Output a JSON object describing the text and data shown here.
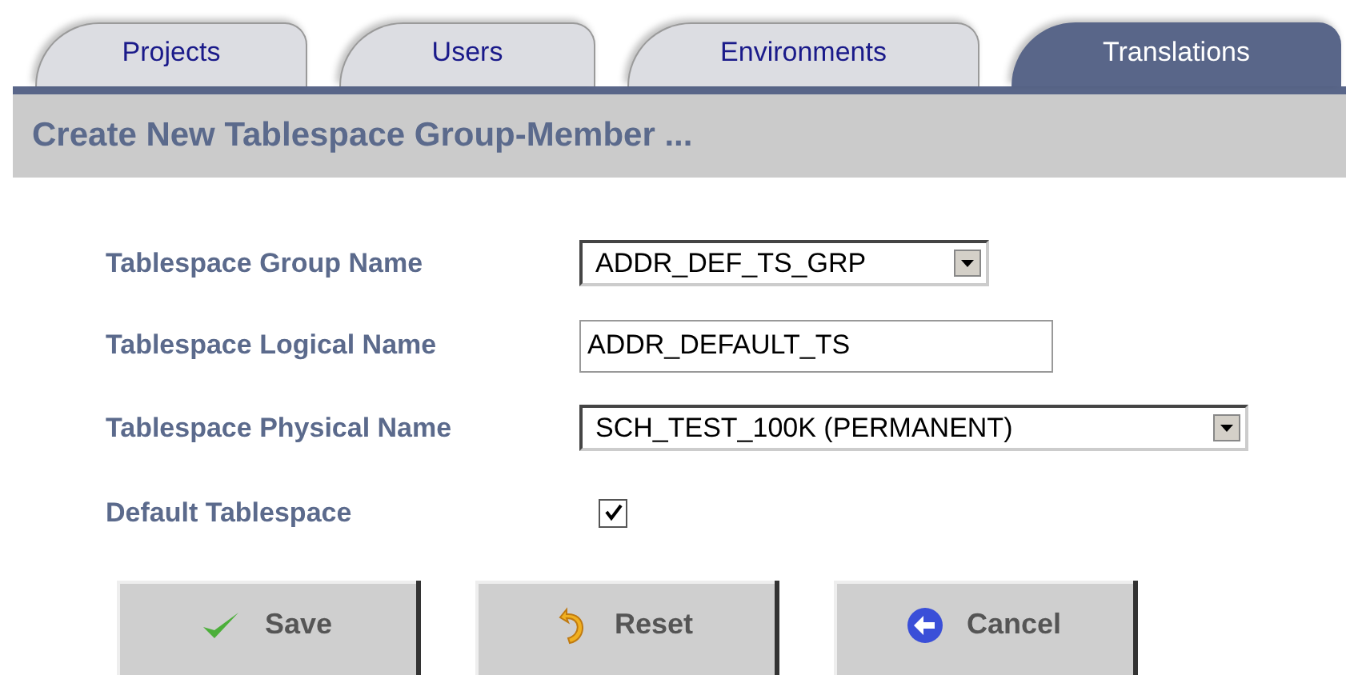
{
  "tabs": [
    {
      "label": "Projects",
      "selected": false
    },
    {
      "label": "Users",
      "selected": false
    },
    {
      "label": "Environments",
      "selected": false
    },
    {
      "label": "Translations",
      "selected": true
    }
  ],
  "header": {
    "title": "Create New Tablespace Group-Member ..."
  },
  "fields": [
    {
      "kind": "select",
      "label": "Tablespace Group Name",
      "value": "ADDR_DEF_TS_GRP",
      "wide": false
    },
    {
      "kind": "text",
      "label": "Tablespace Logical Name",
      "value": "ADDR_DEFAULT_TS"
    },
    {
      "kind": "select",
      "label": "Tablespace Physical Name",
      "value": "SCH_TEST_100K (PERMANENT)",
      "wide": true
    },
    {
      "kind": "checkbox",
      "label": "Default Tablespace",
      "checked": true
    }
  ],
  "buttons": [
    {
      "kind": "save",
      "label": "Save"
    },
    {
      "kind": "reset",
      "label": "Reset"
    },
    {
      "kind": "cancel",
      "label": "Cancel"
    }
  ]
}
